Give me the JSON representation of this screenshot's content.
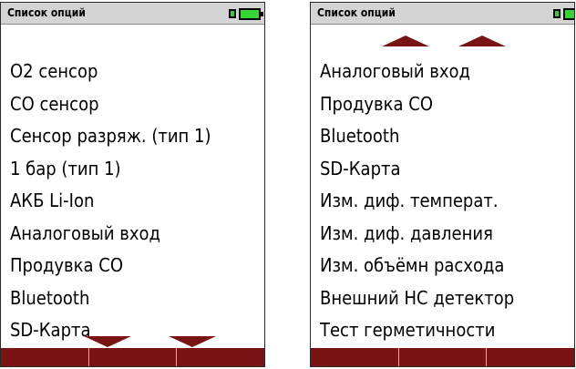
{
  "screens": [
    {
      "title": "Список опций",
      "items": [
        "О2 сенсор",
        "CO сенсор",
        "Сенсор разряж. (тип 1)",
        "1 бар (тип 1)",
        "АКБ Li-Ion",
        "Аналоговый вход",
        "Продувка СО",
        "Bluetooth",
        "SD-Карта"
      ],
      "scroll": "down"
    },
    {
      "title": "Список опций",
      "items": [
        "Аналоговый вход",
        "Продувка СО",
        "Bluetooth",
        "SD-Карта",
        "Изм. диф. температ.",
        "Изм. диф. давления",
        "Изм. объёмн расхода",
        "Внешний НС детектор",
        "Тест герметичности"
      ],
      "scroll": "up"
    }
  ],
  "colors": {
    "header_bg": "#d4d4d4",
    "softkey_bg": "#7a1414",
    "battery_fill": "#34d534",
    "text": "#000000"
  },
  "icons": {
    "plug": "plug-icon",
    "battery": "battery-icon",
    "scroll_down": "scroll-down-arrow-icon",
    "scroll_up": "scroll-up-arrow-icon"
  }
}
